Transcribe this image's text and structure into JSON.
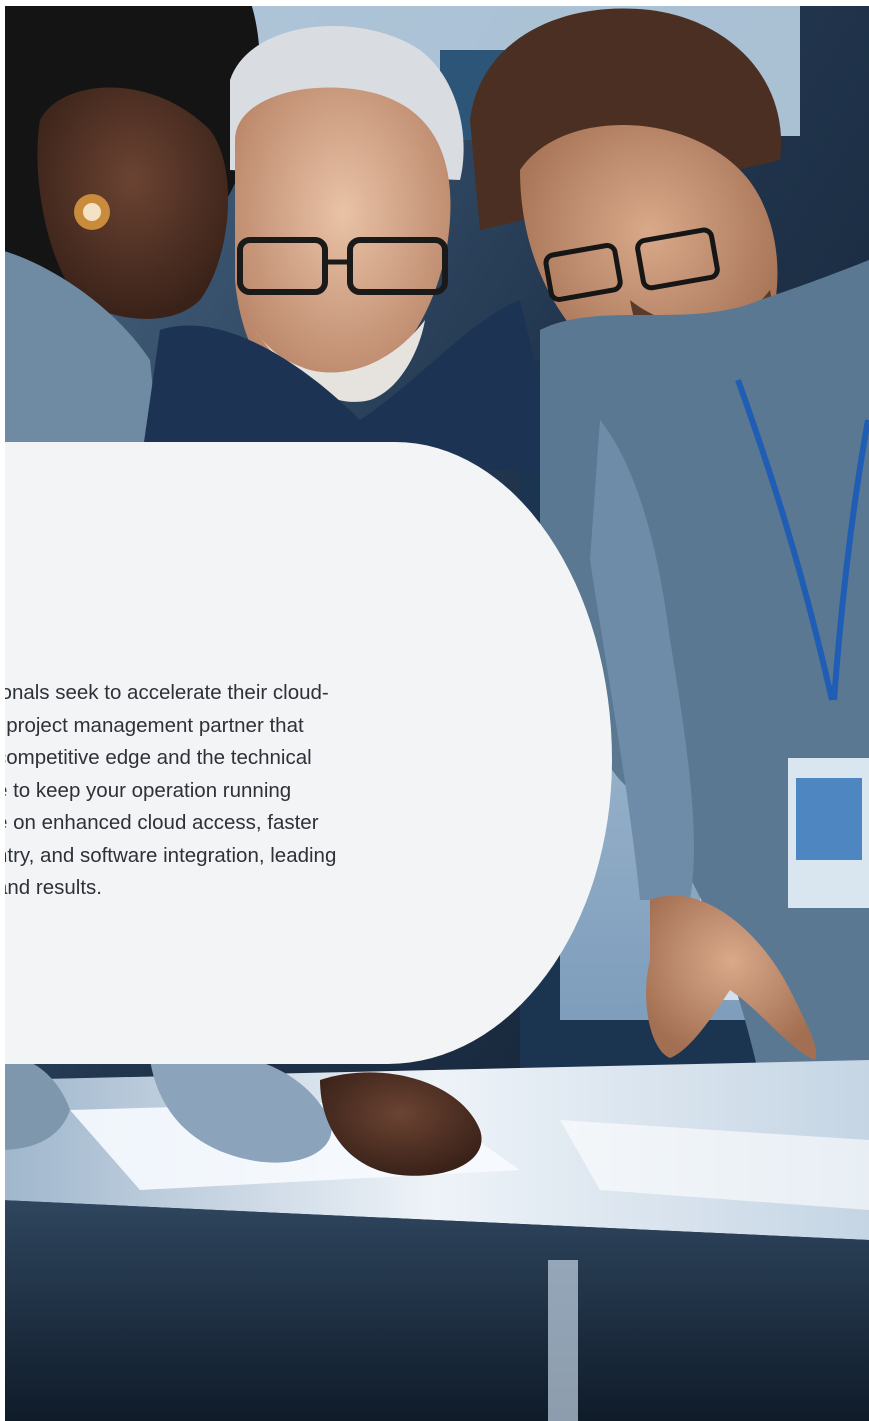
{
  "hero": {
    "image_alt": "Professionals collaborating around a lit table"
  },
  "card": {
    "paragraph_lines": [
      "ionals seek to accelerate their cloud-",
      "l project management partner that",
      "competitive edge and the technical",
      "e to keep your operation running",
      "e on enhanced cloud access, faster",
      "ntry, and software integration, leading",
      "and results."
    ],
    "background": "#f3f4f6",
    "text_color": "#2e3238"
  },
  "colors": {
    "photo_dark": "#0f1f33",
    "photo_blue": "#2b5d86",
    "shirt_blue": "#3e5f7d",
    "lanyard_blue": "#1f5eb4"
  }
}
